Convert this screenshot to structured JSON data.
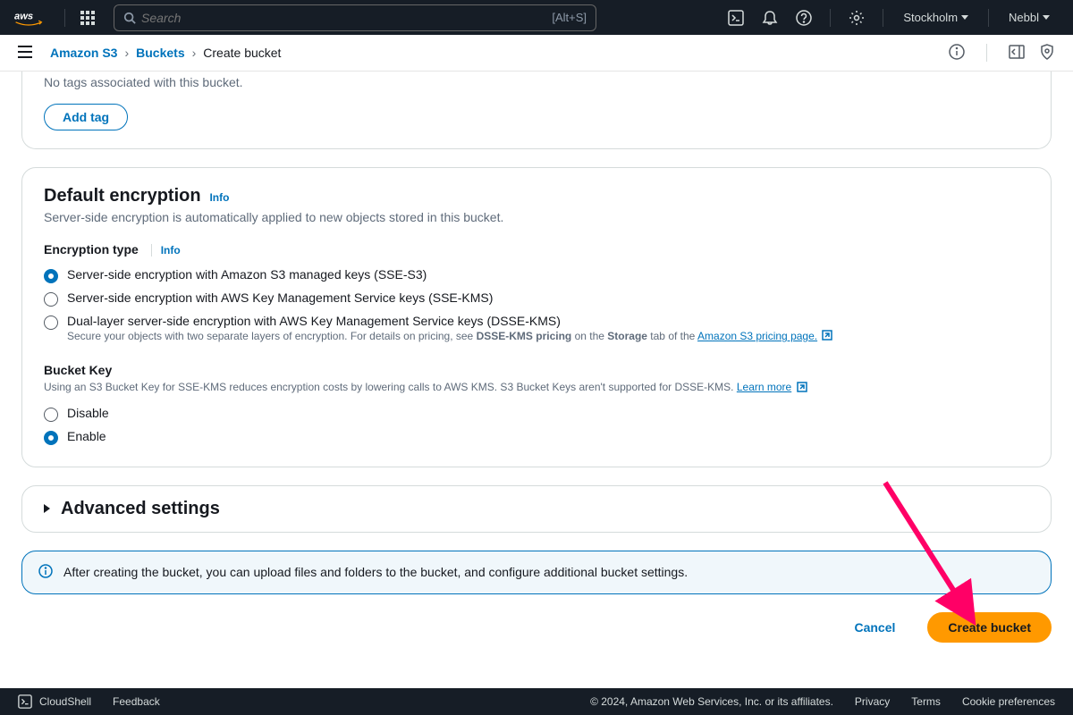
{
  "nav": {
    "search_placeholder": "Search",
    "search_shortcut": "[Alt+S]",
    "region": "Stockholm",
    "account": "Nebbl"
  },
  "breadcrumb": {
    "service": "Amazon S3",
    "buckets": "Buckets",
    "current": "Create bucket"
  },
  "tags": {
    "empty_msg": "No tags associated with this bucket.",
    "add_btn": "Add tag"
  },
  "encryption": {
    "title": "Default encryption",
    "info": "Info",
    "desc": "Server-side encryption is automatically applied to new objects stored in this bucket.",
    "type_label": "Encryption type",
    "opt1": "Server-side encryption with Amazon S3 managed keys (SSE-S3)",
    "opt2": "Server-side encryption with AWS Key Management Service keys (SSE-KMS)",
    "opt3": "Dual-layer server-side encryption with AWS Key Management Service keys (DSSE-KMS)",
    "opt3_sub_pre": "Secure your objects with two separate layers of encryption. For details on pricing, see ",
    "opt3_sub_bold1": "DSSE-KMS pricing",
    "opt3_sub_mid": " on the ",
    "opt3_sub_bold2": "Storage",
    "opt3_sub_post": " tab of the ",
    "opt3_link": "Amazon S3 pricing page.",
    "bucket_key_label": "Bucket Key",
    "bucket_key_help_pre": "Using an S3 Bucket Key for SSE-KMS reduces encryption costs by lowering calls to AWS KMS. S3 Bucket Keys aren't supported for DSSE-KMS. ",
    "learn_more": "Learn more",
    "disable": "Disable",
    "enable": "Enable"
  },
  "advanced": {
    "title": "Advanced settings"
  },
  "info_banner": {
    "text": "After creating the bucket, you can upload files and folders to the bucket, and configure additional bucket settings."
  },
  "actions": {
    "cancel": "Cancel",
    "create": "Create bucket"
  },
  "footer": {
    "cloudshell": "CloudShell",
    "feedback": "Feedback",
    "copyright": "© 2024, Amazon Web Services, Inc. or its affiliates.",
    "privacy": "Privacy",
    "terms": "Terms",
    "cookies": "Cookie preferences"
  }
}
